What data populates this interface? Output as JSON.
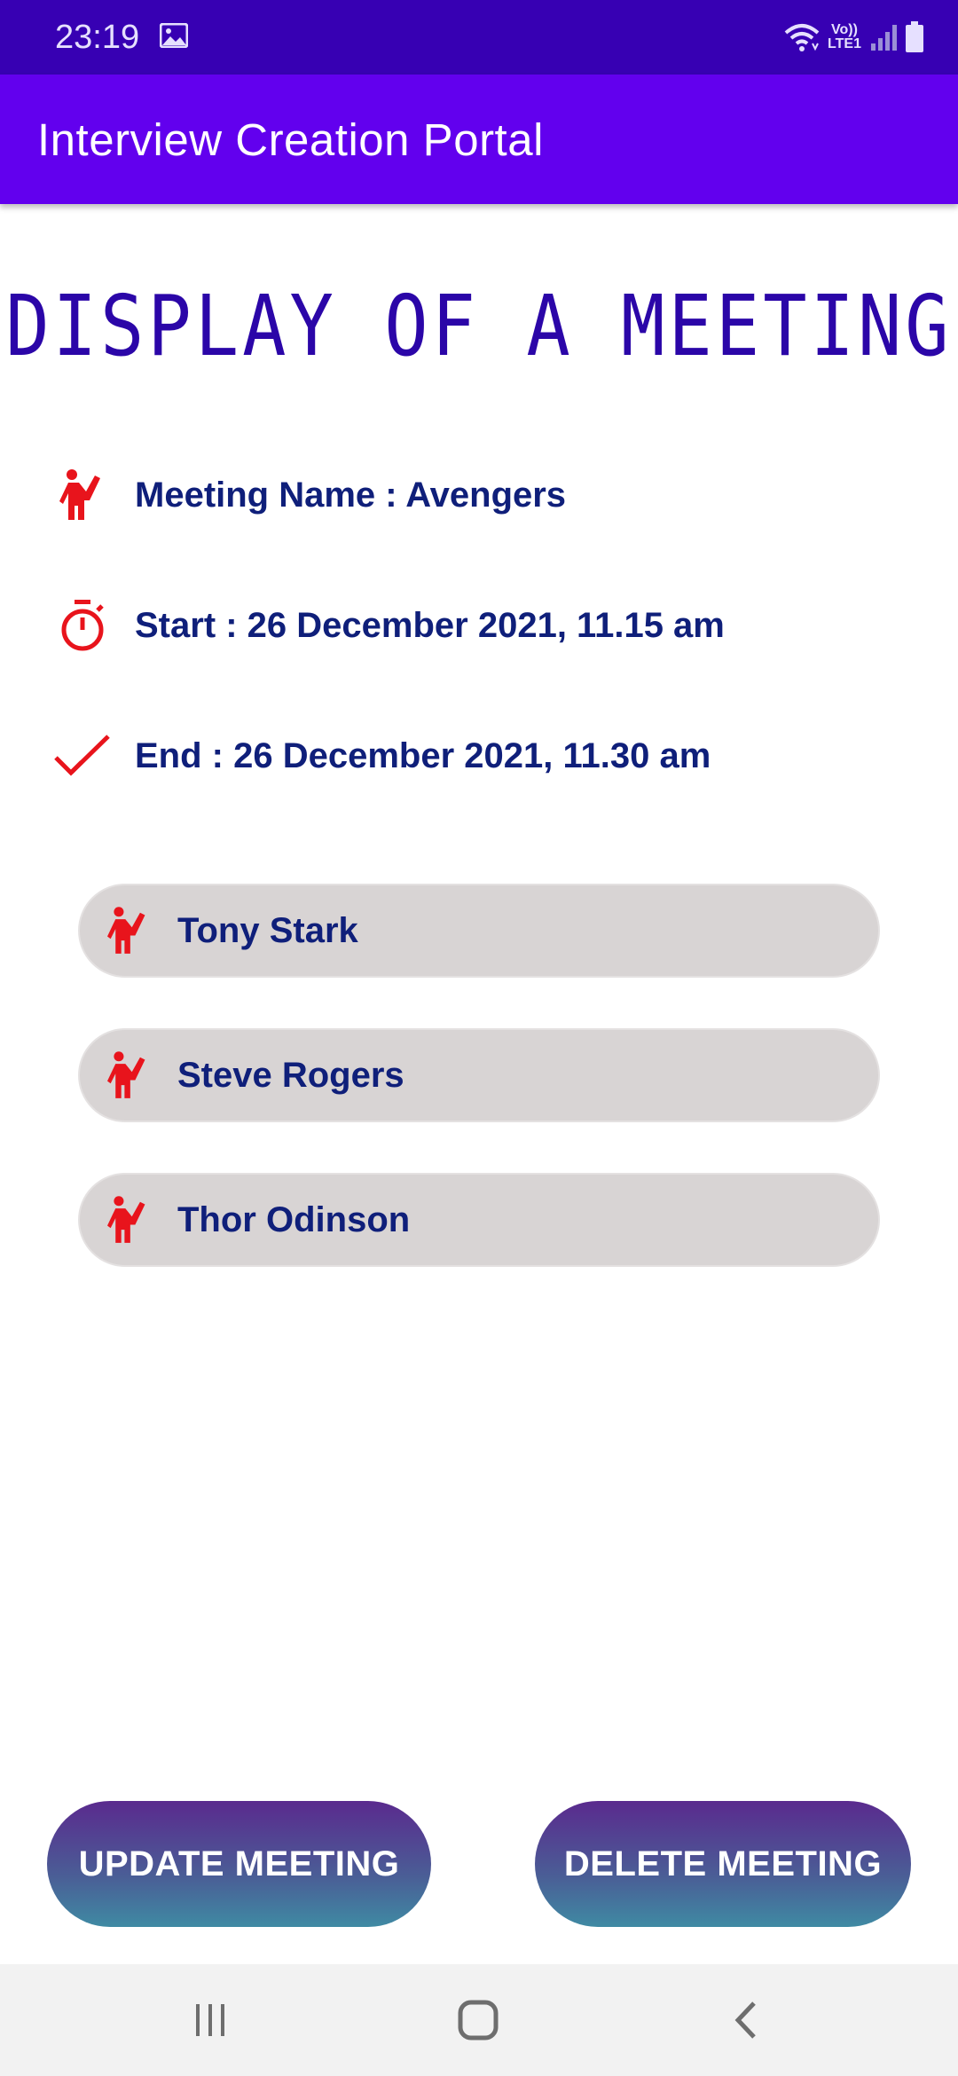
{
  "status_bar": {
    "time": "23:19",
    "network_label_top": "Vo))",
    "network_label_bottom": "LTE1"
  },
  "app_bar": {
    "title": "Interview Creation Portal"
  },
  "page": {
    "heading": "DISPLAY OF A MEETING"
  },
  "meeting": {
    "name_line": "Meeting Name : Avengers",
    "start_line": "Start : 26 December 2021, 11.15 am",
    "end_line": "End : 26 December 2021, 11.30 am"
  },
  "participants": [
    {
      "name": "Tony Stark"
    },
    {
      "name": "Steve Rogers"
    },
    {
      "name": "Thor Odinson"
    }
  ],
  "actions": {
    "update_label": "UPDATE MEETING",
    "delete_label": "DELETE MEETING"
  },
  "icons": {
    "meeting_name": "person-waving-icon",
    "start": "timer-icon",
    "end": "check-icon",
    "participant": "person-waving-icon",
    "nav_recents": "recents-icon",
    "nav_home": "home-icon",
    "nav_back": "back-icon"
  },
  "colors": {
    "status_bar": "#3700b3",
    "app_bar": "#6200ee",
    "heading": "#2b06a8",
    "text": "#0f1f7a",
    "icon_red": "#e8141c",
    "chip_bg": "#d8d4d4"
  }
}
